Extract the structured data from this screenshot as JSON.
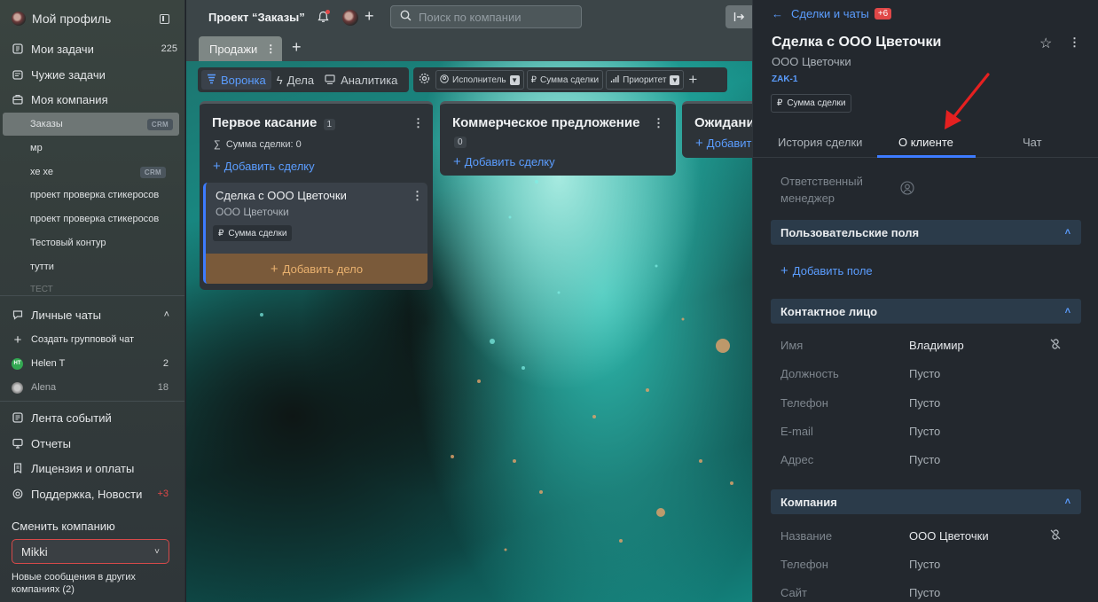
{
  "sidebar": {
    "profile_label": "Мой профиль",
    "items": [
      {
        "label": "Мои задачи",
        "count": "225"
      },
      {
        "label": "Чужие задачи"
      },
      {
        "label": "Моя компания"
      }
    ],
    "company_items": [
      {
        "label": "Заказы",
        "badge": "CRM"
      },
      {
        "label": "мр"
      },
      {
        "label": "хе хе",
        "badge": "CRM"
      },
      {
        "label": "проект проверка стикеросов"
      },
      {
        "label": "проект проверка стикеросов"
      },
      {
        "label": "Тестовый контур"
      },
      {
        "label": "тутти"
      },
      {
        "label": "ТЕСТ"
      }
    ],
    "chats_label": "Личные чаты",
    "create_group_chat": "Создать групповой чат",
    "chats": [
      {
        "name": "Helen T",
        "initials": "HT",
        "count": "2"
      },
      {
        "name": "Alena",
        "count": "18"
      }
    ],
    "bottom_items": [
      {
        "label": "Лента событий"
      },
      {
        "label": "Отчеты"
      },
      {
        "label": "Лицензия и оплаты"
      },
      {
        "label": "Поддержка, Новости",
        "count": "+3"
      }
    ],
    "switch_company_label": "Сменить компанию",
    "company_value": "Mikki",
    "new_messages": "Новые сообщения в других компаниях (2)"
  },
  "header": {
    "project_title": "Проект “Заказы”",
    "search_placeholder": "Поиск по компании",
    "tab": "Продажи"
  },
  "toolbar": {
    "views": [
      "Воронка",
      "Дела",
      "Аналитика"
    ],
    "filters": [
      "Исполнитель",
      "Сумма сделки",
      "Приоритет"
    ]
  },
  "board": {
    "columns": [
      {
        "title": "Первое касание",
        "count": "1",
        "sum_label": "Сумма сделки: 0",
        "add_label": "Добавить сделку"
      },
      {
        "title": "Коммерческое предложение",
        "count": "0",
        "add_label": "Добавить сделку"
      },
      {
        "title": "Ожидание",
        "add_label": "Добавить"
      }
    ],
    "card": {
      "title": "Сделка с ООО Цветочки",
      "subtitle": "ООО Цветочки",
      "tag": "Сумма сделки",
      "add_action": "Добавить дело"
    }
  },
  "panel": {
    "back_label": "Сделки и чаты",
    "back_badge": "+6",
    "title": "Сделка с ООО Цветочки",
    "subtitle": "ООО Цветочки",
    "code": "ZAK-1",
    "tag": "Сумма сделки",
    "tabs": [
      "История сделки",
      "О клиенте",
      "Чат"
    ],
    "active_tab": "О клиенте",
    "manager_label": "Ответственный менеджер",
    "custom_fields": {
      "title": "Пользовательские поля",
      "add_label": "Добавить поле"
    },
    "contact": {
      "title": "Контактное лицо",
      "fields": [
        {
          "label": "Имя",
          "value": "Владимир"
        },
        {
          "label": "Должность",
          "value": "Пусто"
        },
        {
          "label": "Телефон",
          "value": "Пусто"
        },
        {
          "label": "E-mail",
          "value": "Пусто"
        },
        {
          "label": "Адрес",
          "value": "Пусто"
        }
      ]
    },
    "company": {
      "title": "Компания",
      "fields": [
        {
          "label": "Название",
          "value": "ООО Цветочки"
        },
        {
          "label": "Телефон",
          "value": "Пусто"
        },
        {
          "label": "Сайт",
          "value": "Пусто"
        }
      ]
    }
  },
  "colors": {
    "accent": "#3d7bff",
    "link": "#5b9dff",
    "alert": "#e04848",
    "arrow": "#e52020"
  },
  "icons": [
    "panel-toggle-icon",
    "tasks-icon",
    "other-tasks-icon",
    "company-icon",
    "chevron-up-icon",
    "plus-icon",
    "feed-icon",
    "reports-icon",
    "license-icon",
    "support-icon",
    "bell-icon",
    "search-icon",
    "kebab-icon",
    "funnel-icon",
    "bolt-icon",
    "chart-icon",
    "gear-icon",
    "user-icon",
    "filter-icon",
    "ruble-icon",
    "sigma-icon",
    "arrow-left-icon",
    "star-icon",
    "unlink-icon",
    "exit-icon"
  ]
}
